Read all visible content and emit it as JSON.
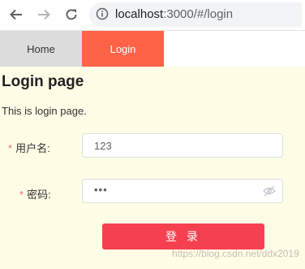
{
  "browser": {
    "url_host": "localhost",
    "url_rest": ":3000/#/login",
    "icons": [
      "back-icon",
      "forward-icon",
      "reload-icon",
      "info-icon"
    ]
  },
  "nav": {
    "home_label": "Home",
    "login_label": "Login"
  },
  "page": {
    "title": "Login page",
    "description": "This is login page."
  },
  "form": {
    "username_label": "用户名:",
    "username_value": "123",
    "password_label": "密码:",
    "password_value": "•••",
    "required_mark": "*",
    "submit_label": "登 录"
  },
  "watermark": "https://blog.csdn.net/ddx2019",
  "colors": {
    "page_background": "#fffde6",
    "login_tab": "#ff6347",
    "home_tab": "#dcdcdc",
    "submit_button": "#f5414f",
    "required": "#f56c6c"
  }
}
